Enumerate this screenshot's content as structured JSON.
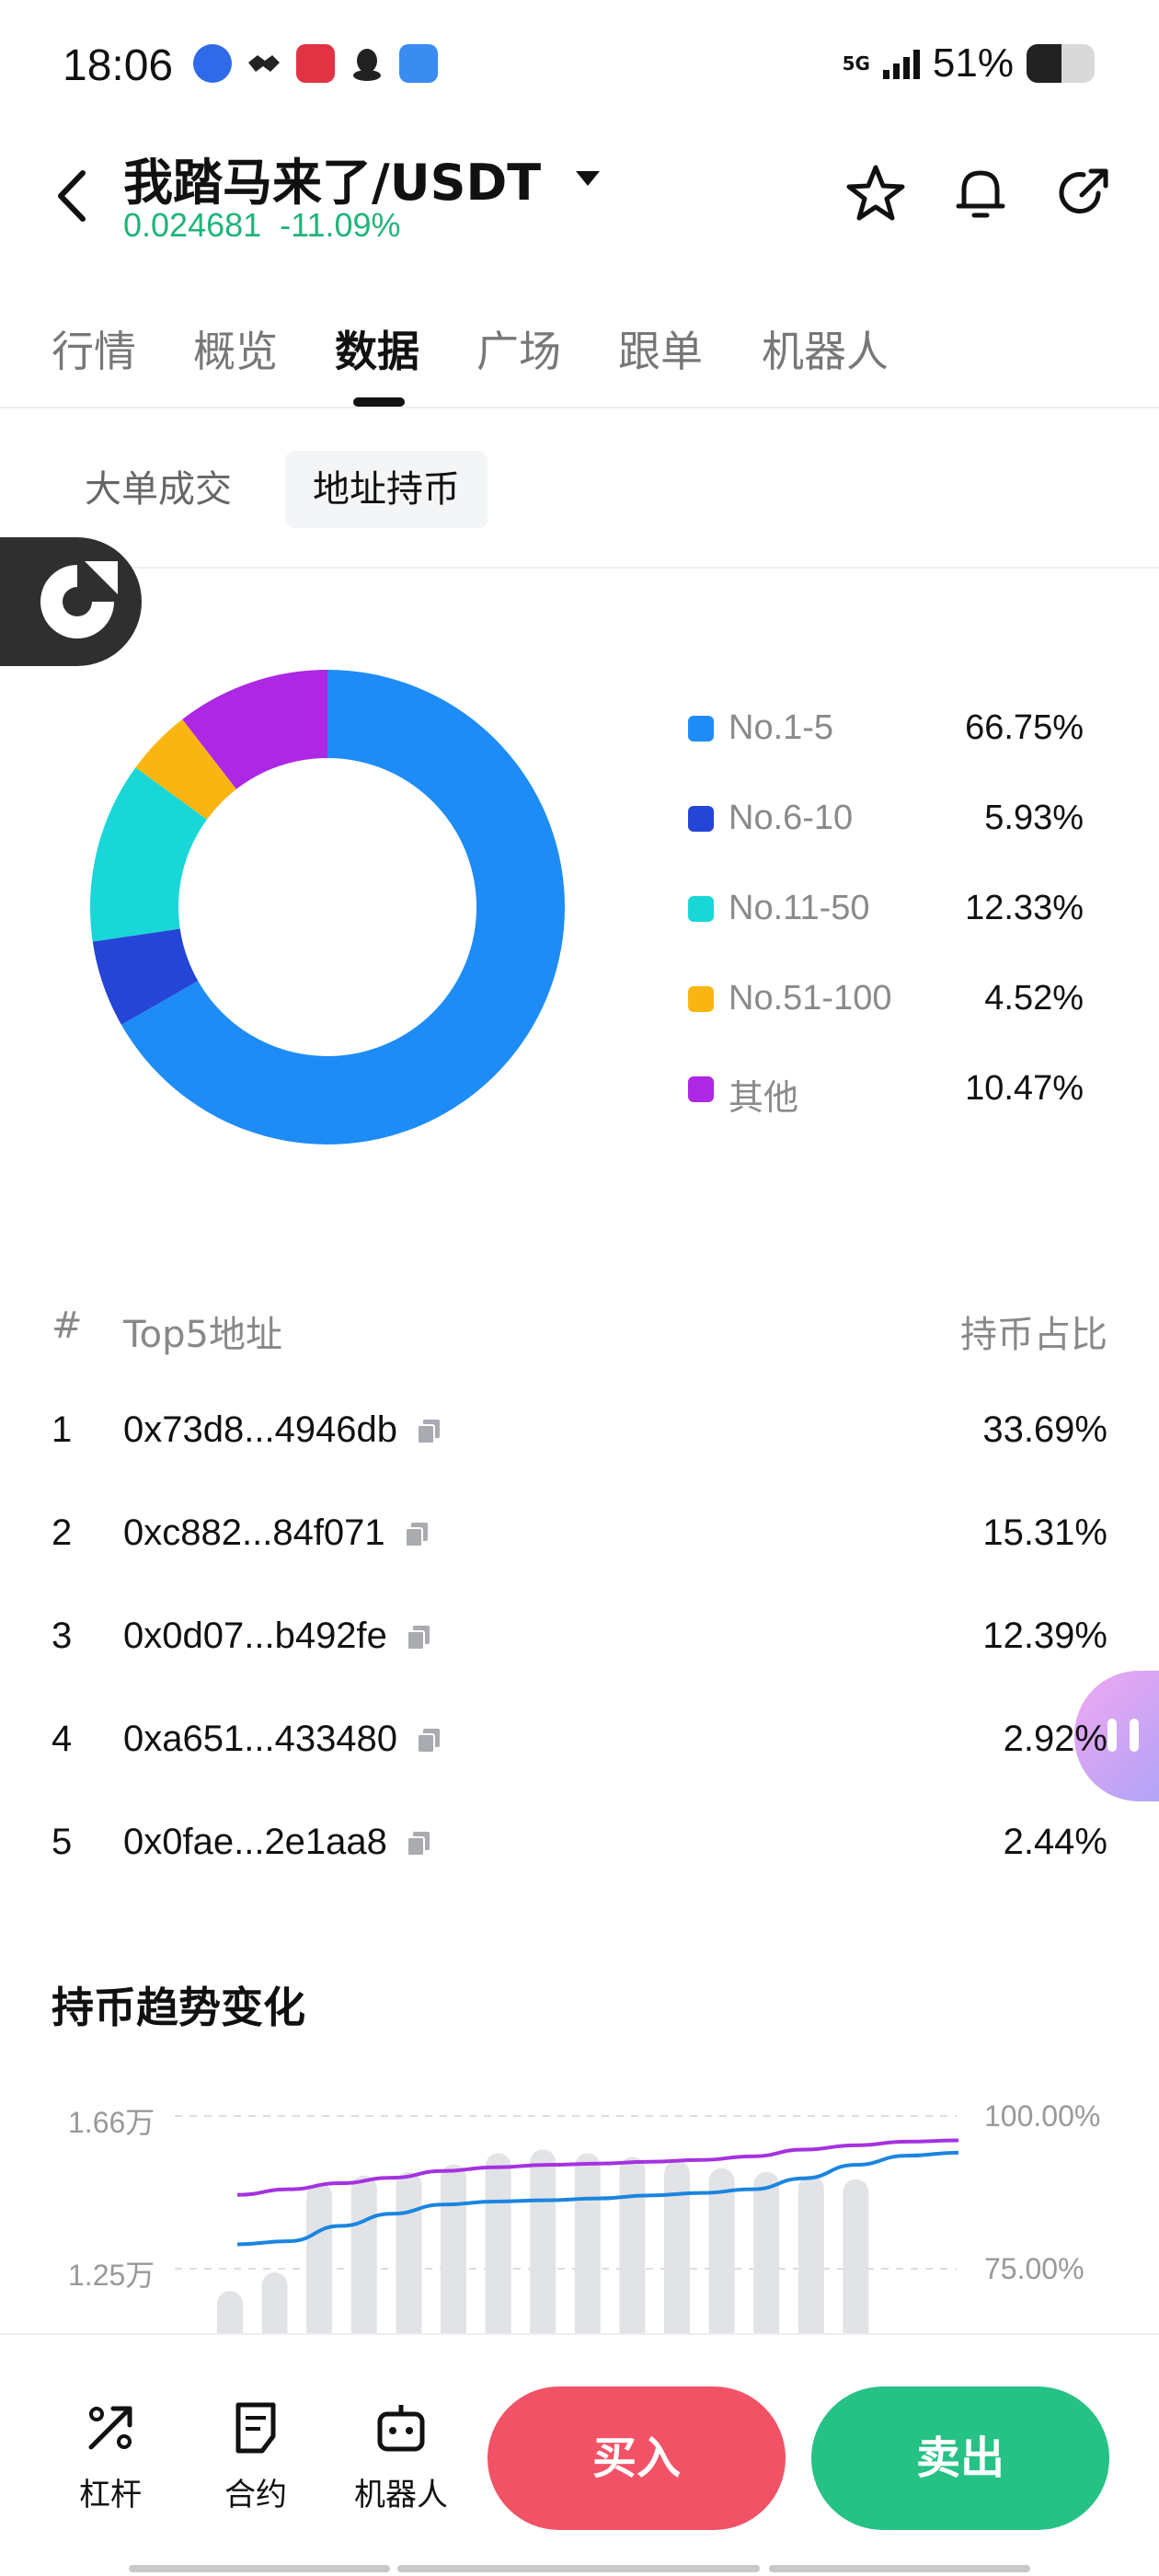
{
  "status_bar": {
    "time": "18:06",
    "network": "5G",
    "battery_text": "51%",
    "battery_level": 0.51,
    "signal_bars": 4
  },
  "header": {
    "title": "我踏马来了/USDT",
    "price": "0.024681",
    "change": "-11.09%",
    "price_color": "#20b47a",
    "icons": [
      "back-icon",
      "caret-down-icon",
      "star-icon",
      "bell-icon",
      "share-icon"
    ]
  },
  "tabs": [
    {
      "label": "行情",
      "active": false
    },
    {
      "label": "概览",
      "active": false
    },
    {
      "label": "数据",
      "active": true
    },
    {
      "label": "广场",
      "active": false
    },
    {
      "label": "跟单",
      "active": false
    },
    {
      "label": "机器人",
      "active": false
    }
  ],
  "subtabs": [
    {
      "label": "大单成交",
      "active": false
    },
    {
      "label": "地址持币",
      "active": true
    }
  ],
  "chart_data": [
    {
      "type": "pie",
      "categories": [
        "No.1-5",
        "No.6-10",
        "No.11-50",
        "No.51-100",
        "其他"
      ],
      "values": [
        66.75,
        5.93,
        12.33,
        4.52,
        10.47
      ],
      "value_labels": [
        "66.75%",
        "5.93%",
        "12.33%",
        "4.52%",
        "10.47%"
      ],
      "colors": [
        "#1e8cf6",
        "#2545d6",
        "#19d7d7",
        "#f9b613",
        "#ad27e4"
      ],
      "donut": true,
      "legend": "right"
    },
    {
      "type": "line",
      "title": "持币趋势变化",
      "y_left_ticks": [
        "1.66万",
        "1.25万"
      ],
      "y_right_ticks": [
        "100.00%",
        "75.00%"
      ],
      "y_left_range": [
        12500,
        16600
      ],
      "y_right_range": [
        75,
        100
      ],
      "bars_left_axis": [
        11900,
        12400,
        14800,
        15000,
        15100,
        15300,
        15600,
        15700,
        15600,
        15500,
        15400,
        15200,
        15100,
        15000,
        14900
      ],
      "series": [
        {
          "color": "#a532e0",
          "values": [
            87.1,
            88.0,
            89.0,
            89.9,
            91.0,
            91.6,
            92.0,
            92.2,
            92.5,
            92.8,
            93.4,
            94.5,
            95.2,
            95.8,
            96.0
          ]
        },
        {
          "color": "#1a85e0",
          "values": [
            79.0,
            79.5,
            82.0,
            84.0,
            85.5,
            86.0,
            86.2,
            86.5,
            87.0,
            87.4,
            88.0,
            89.8,
            92.0,
            93.5,
            94.0
          ]
        }
      ],
      "grid": true,
      "bar_color": "#e2e3e6"
    }
  ],
  "top5": {
    "headers": {
      "index": "#",
      "address": "Top5地址",
      "ratio": "持币占比"
    },
    "rows": [
      {
        "index": "1",
        "address": "0x73d8...4946db",
        "ratio": "33.69%"
      },
      {
        "index": "2",
        "address": "0xc882...84f071",
        "ratio": "15.31%"
      },
      {
        "index": "3",
        "address": "0x0d07...b492fe",
        "ratio": "12.39%"
      },
      {
        "index": "4",
        "address": "0xa651...433480",
        "ratio": "2.92%"
      },
      {
        "index": "5",
        "address": "0x0fae...2e1aa8",
        "ratio": "2.44%"
      }
    ]
  },
  "bottom_bar": {
    "items": [
      {
        "label": "杠杆",
        "icon": "leverage-icon"
      },
      {
        "label": "合约",
        "icon": "contract-icon"
      },
      {
        "label": "机器人",
        "icon": "robot-icon"
      }
    ],
    "buy_label": "买入",
    "sell_label": "卖出",
    "buy_color": "#f25266",
    "sell_color": "#26c185"
  }
}
